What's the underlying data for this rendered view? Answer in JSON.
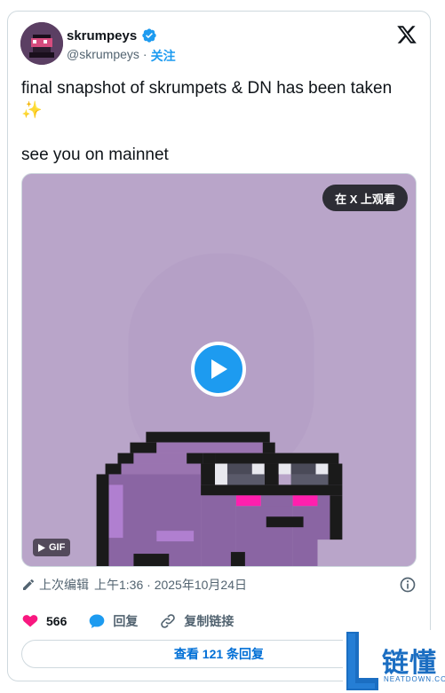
{
  "author": {
    "display_name": "skrumpeys",
    "handle": "@skrumpeys",
    "separator": "·",
    "follow_label": "关注"
  },
  "tweet": {
    "line1": "final snapshot of skrumpets & DN has been taken",
    "line1_emoji": "✨",
    "line2": "see you on mainnet"
  },
  "media": {
    "watch_on_x_label": "在 X 上观看",
    "gif_label": "GIF",
    "bg_color": "#b9a5c9"
  },
  "meta": {
    "edited_label": "上次编辑",
    "timestamp": "上午1:36 · 2025年10月24日"
  },
  "actions": {
    "likes_count": "566",
    "reply_label": "回复",
    "copy_link_label": "复制链接"
  },
  "replies_button": {
    "label": "查看 121 条回复"
  },
  "watermark": {
    "chinese": "链懂",
    "english": "NEATDOWN.COM"
  },
  "colors": {
    "accent": "#1d9bf0",
    "like": "#f91880",
    "link": "#006fd6"
  }
}
